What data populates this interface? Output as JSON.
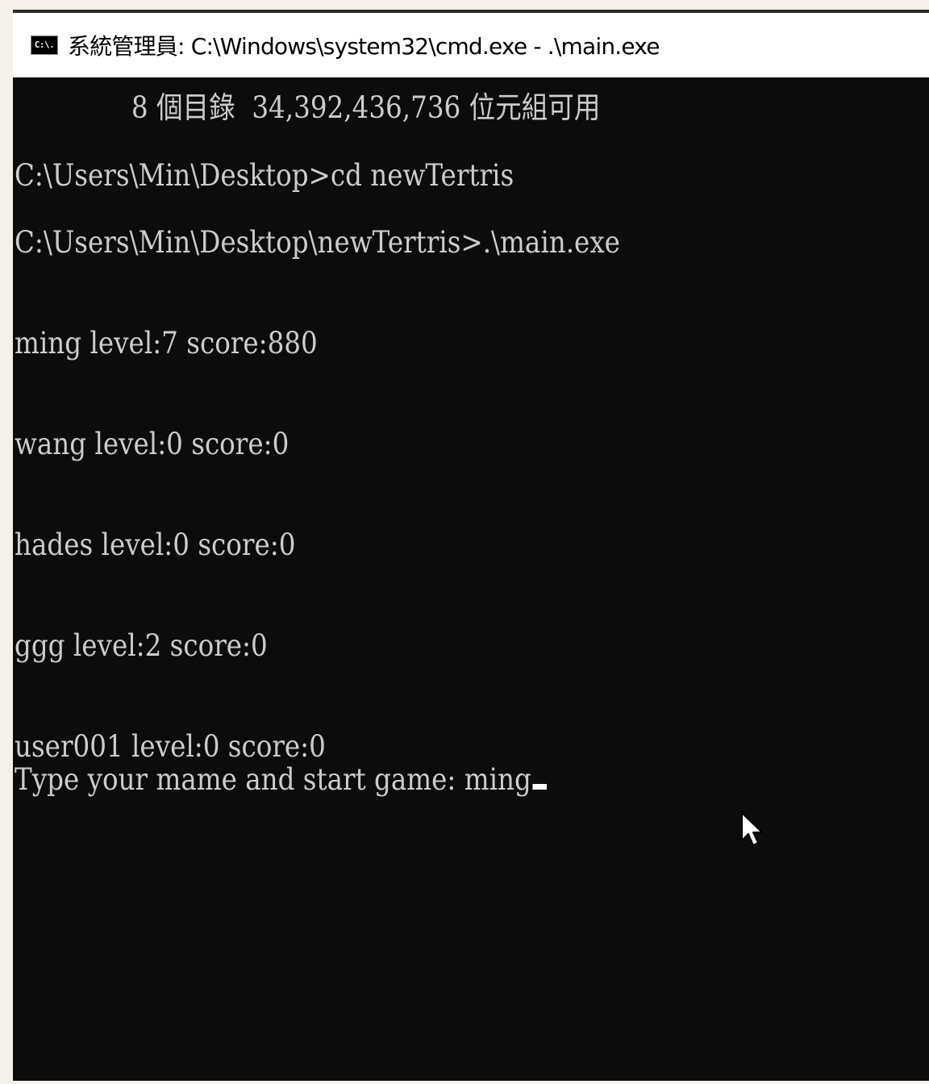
{
  "window": {
    "icon_text": "C:\\.",
    "title": "系統管理員: C:\\Windows\\system32\\cmd.exe - .\\main.exe"
  },
  "terminal": {
    "lines": [
      "              8 個目錄  34,392,436,736 位元組可用",
      "C:\\Users\\Min\\Desktop>cd newTertris",
      "C:\\Users\\Min\\Desktop\\newTertris>.\\main.exe",
      "ming level:7 score:880",
      "wang level:0 score:0",
      "hades level:0 score:0",
      "ggg level:2 score:0",
      "user001 level:0 score:0",
      "Type your mame and start game: ming"
    ]
  },
  "colors": {
    "terminal_background": "#0c0c0c",
    "terminal_text": "#cccccc",
    "titlebar_background": "#ffffff",
    "page_background": "#f5f1ea"
  },
  "icons": {
    "app": "cmd-console-icon",
    "pointer": "mouse-pointer-icon"
  }
}
